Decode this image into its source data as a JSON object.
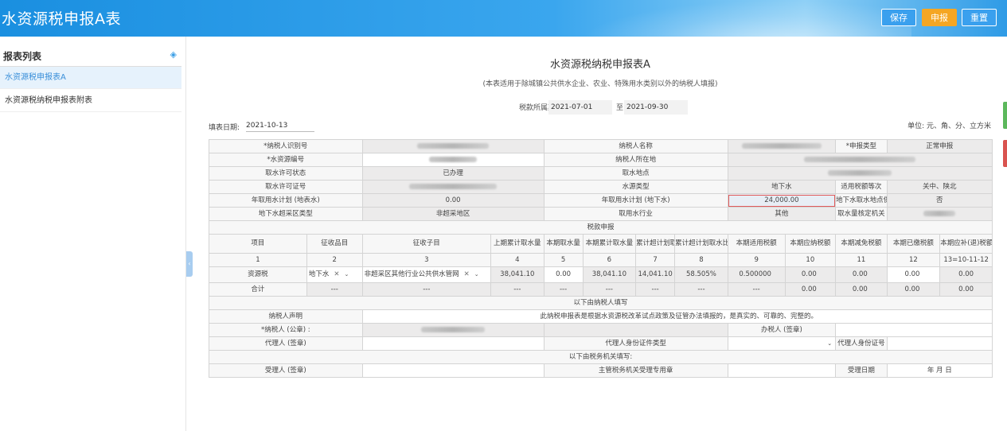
{
  "app": {
    "title": "水资源税申报A表"
  },
  "toolbar": {
    "save": "保存",
    "submit": "申报",
    "reset": "重置"
  },
  "sidebar": {
    "title": "报表列表",
    "items": [
      {
        "label": "水资源税申报表A",
        "active": true
      },
      {
        "label": "水资源税纳税申报表附表",
        "active": false
      }
    ]
  },
  "report": {
    "title": "水资源税纳税申报表A",
    "subtitle": "(本表适用于除城镇公共供水企业、农业、特殊用水类别以外的纳税人填报)",
    "period_label": "税款所属期",
    "period_from": "2021-07-01",
    "period_to_label": "至",
    "period_to": "2021-09-30",
    "fill_date_label": "填表日期:",
    "fill_date": "2021-10-13",
    "unit": "单位: 元、角、分、立方米"
  },
  "info": {
    "taxpayer_id": "*纳税人识别号",
    "taxpayer_name": "纳税人名称",
    "decl_type_label": "*申报类型",
    "decl_type_value": "正常申报",
    "water_code": "*水资源编号",
    "taxpayer_location": "纳税人所在地",
    "permit_status_label": "取水许可状态",
    "permit_status_value": "已办理",
    "intake_location": "取水地点",
    "permit_no": "取水许可证号",
    "source_type_label": "水源类型",
    "source_type_value": "地下水",
    "tax_level_label": "适用税额等次",
    "tax_level_value": "关中、陕北",
    "annual_surface_label": "年取用水计划 (地表水)",
    "annual_surface_value": "0.00",
    "annual_ground_label": "年取用水计划 (地下水)",
    "annual_ground_value": "24,000.00",
    "pipe_label": "地下水取水地点供水管网是否已覆盖",
    "pipe_value": "否",
    "overexploit_label": "地下水超采区类型",
    "overexploit_value": "非超采地区",
    "industry_label": "取用水行业",
    "industry_value": "其他",
    "authority_label": "取水量核定机关"
  },
  "tax": {
    "section": "税款申报",
    "headers": [
      "项目",
      "征收品目",
      "征收子目",
      "上期累计取水量",
      "本期取水量",
      "本期累计取水量",
      "累计超计划取水量",
      "累计超计划取水比例",
      "本期适用税额",
      "本期应纳税额",
      "本期减免税额",
      "本期已缴税额",
      "本期应补(退)税额"
    ],
    "index": [
      "1",
      "2",
      "3",
      "4",
      "5",
      "6",
      "7",
      "8",
      "9",
      "10",
      "11",
      "12",
      "13=10-11-12"
    ],
    "row": {
      "item": "资源税",
      "category": "地下水",
      "subcategory": "非超采区其他行业公共供水管网",
      "prev_cum": "38,041.10",
      "current": "0.00",
      "cum": "38,041.10",
      "over": "14,041.10",
      "over_ratio": "58.505%",
      "rate": "0.500000",
      "payable": "0.00",
      "relief": "0.00",
      "paid": "0.00",
      "due": "0.00"
    },
    "total": {
      "label": "合计",
      "dash": "---",
      "payable": "0.00",
      "relief": "0.00",
      "paid": "0.00",
      "due": "0.00"
    }
  },
  "taxpayer_section": {
    "title": "以下由纳税人填写",
    "declaration_label": "纳税人声明",
    "declaration_text": "此纳税申报表是根据水资源税改革试点政策及征管办法填报的，是真实的、可靠的、完整的。",
    "seal_label": "*纳税人 (公章) :",
    "handler_label": "办税人 (签章)",
    "agent_label": "代理人 (签章)",
    "agent_id_type_label": "代理人身份证件类型",
    "agent_id_no_label": "代理人身份证号"
  },
  "authority_section": {
    "title": "以下由税务机关填写:",
    "receiver_label": "受理人 (签章)",
    "seal_label": "主管税务机关受理专用章",
    "date_label": "受理日期",
    "date_value": "年 月 日"
  }
}
